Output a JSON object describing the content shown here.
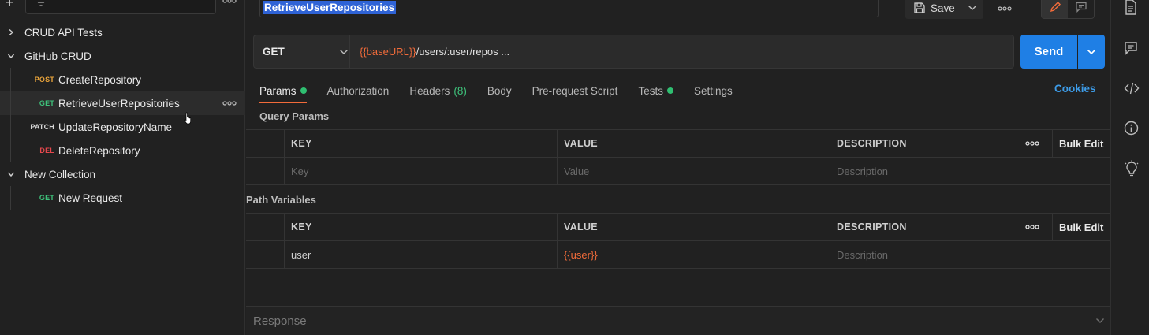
{
  "sidebar": {
    "collections": [
      {
        "name": "CRUD API Tests",
        "expanded": false
      },
      {
        "name": "GitHub CRUD",
        "expanded": true
      },
      {
        "name": "New Collection",
        "expanded": true
      }
    ],
    "requests": [
      {
        "method": "POST",
        "name": "CreateRepository",
        "method_color": "#e8a33a"
      },
      {
        "method": "GET",
        "name": "RetrieveUserRepositories",
        "method_color": "#3ec27b",
        "selected": true
      },
      {
        "method": "PATCH",
        "name": "UpdateRepositoryName",
        "method_color": "#d8d8d8"
      },
      {
        "method": "DEL",
        "name": "DeleteRepository",
        "method_color": "#e5484d"
      },
      {
        "method": "GET",
        "name": "New Request",
        "method_color": "#3ec27b"
      }
    ]
  },
  "header": {
    "request_name": "RetrieveUserRepositories",
    "save_label": "Save"
  },
  "request": {
    "method": "GET",
    "url_variable": "{{baseURL}}",
    "url_rest": "/users/:user/repos ...",
    "send_label": "Send"
  },
  "tabs": [
    {
      "label": "Params",
      "dot": true,
      "active": true
    },
    {
      "label": "Authorization"
    },
    {
      "label": "Headers",
      "count": "(8)"
    },
    {
      "label": "Body"
    },
    {
      "label": "Pre-request Script"
    },
    {
      "label": "Tests",
      "dot": true
    },
    {
      "label": "Settings"
    }
  ],
  "cookies_label": "Cookies",
  "query_params": {
    "title": "Query Params",
    "columns": [
      "KEY",
      "VALUE",
      "DESCRIPTION"
    ],
    "bulk_edit": "Bulk Edit",
    "placeholder": {
      "key": "Key",
      "value": "Value",
      "description": "Description"
    }
  },
  "path_variables": {
    "title": "Path Variables",
    "columns": [
      "KEY",
      "VALUE",
      "DESCRIPTION"
    ],
    "bulk_edit": "Bulk Edit",
    "row": {
      "key": "user",
      "value": "{{user}}",
      "description_placeholder": "Description"
    }
  },
  "response": {
    "label": "Response"
  },
  "colors": {
    "accent": "#f26b3a",
    "send_blue": "#1f7fe5",
    "link_blue": "#3d9ce8",
    "dot_green": "#2fbf71",
    "selection_blue": "#2f63d6"
  }
}
